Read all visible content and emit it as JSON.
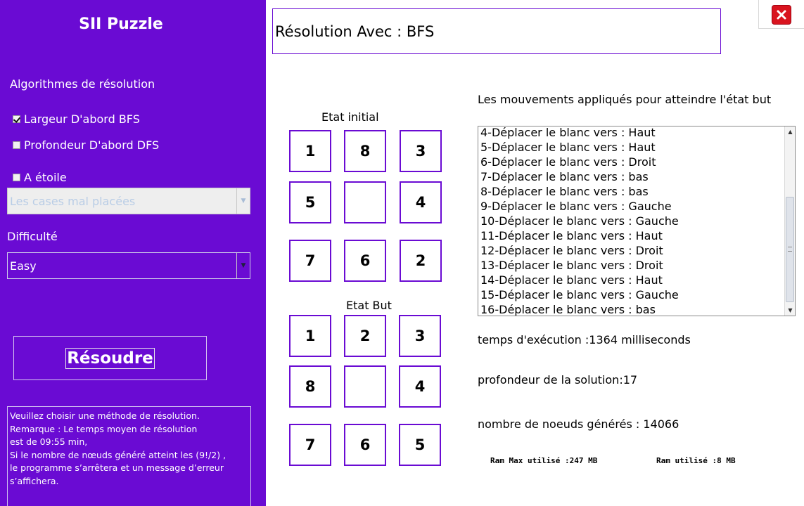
{
  "sidebar": {
    "app_title": "SII Puzzle",
    "algorithms_label": "Algorithmes de résolution",
    "options": [
      {
        "label": "Largeur D'abord  BFS",
        "checked": true
      },
      {
        "label": "Profondeur  D'abord  DFS",
        "checked": false
      },
      {
        "label": "A étoile",
        "checked": false
      }
    ],
    "heuristic_select": {
      "value": "Les cases mal placées",
      "disabled": true
    },
    "difficulty_label": "Difficulté",
    "difficulty_select": {
      "value": "Easy"
    },
    "solve_button": "Résoudre",
    "info_lines": [
      "Veuillez choisir une méthode de résolution.",
      "Remarque : Le temps moyen de résolution",
      "est de 09:55 min,",
      "Si le nombre de nœuds généré atteint  les (9!/2) ,",
      "le programme s’arrêtera et un message d’erreur",
      "s’affichera."
    ]
  },
  "header": {
    "title": "Résolution Avec : BFS"
  },
  "window": {
    "close_icon": "close-x-icon",
    "close_color": "#d9141f"
  },
  "initial_state": {
    "title": "Etat initial",
    "tiles": [
      "1",
      "8",
      "3",
      "5",
      "",
      "4",
      "7",
      "6",
      "2"
    ]
  },
  "goal_state": {
    "title": "Etat But",
    "tiles": [
      "1",
      "2",
      "3",
      "8",
      "",
      "4",
      "7",
      "6",
      "5"
    ]
  },
  "moves": {
    "label": "Les mouvements appliqués pour atteindre l'état but",
    "items": [
      "4-Déplacer le blanc  vers : Haut",
      "5-Déplacer le blanc  vers : Haut",
      "6-Déplacer le blanc  vers : Droit",
      "7-Déplacer le blanc  vers : bas",
      "8-Déplacer le blanc  vers : bas",
      "9-Déplacer le blanc  vers : Gauche",
      "10-Déplacer le blanc  vers : Gauche",
      "11-Déplacer le blanc  vers : Haut",
      "12-Déplacer le blanc  vers : Droit",
      "13-Déplacer le blanc  vers : Droit",
      "14-Déplacer le blanc  vers : Haut",
      "15-Déplacer le blanc  vers : Gauche",
      "16-Déplacer le blanc  vers : bas"
    ]
  },
  "stats": {
    "time": "temps d'exécution :1364 milliseconds",
    "depth": "profondeur de la solution:17",
    "nodes": "nombre de noeuds générés : 14066",
    "ram_max": "Ram Max utilisé :247 MB",
    "ram_used": "Ram utilisé :8 MB"
  },
  "colors": {
    "accent": "#6a0bd3",
    "close": "#d9141f"
  }
}
